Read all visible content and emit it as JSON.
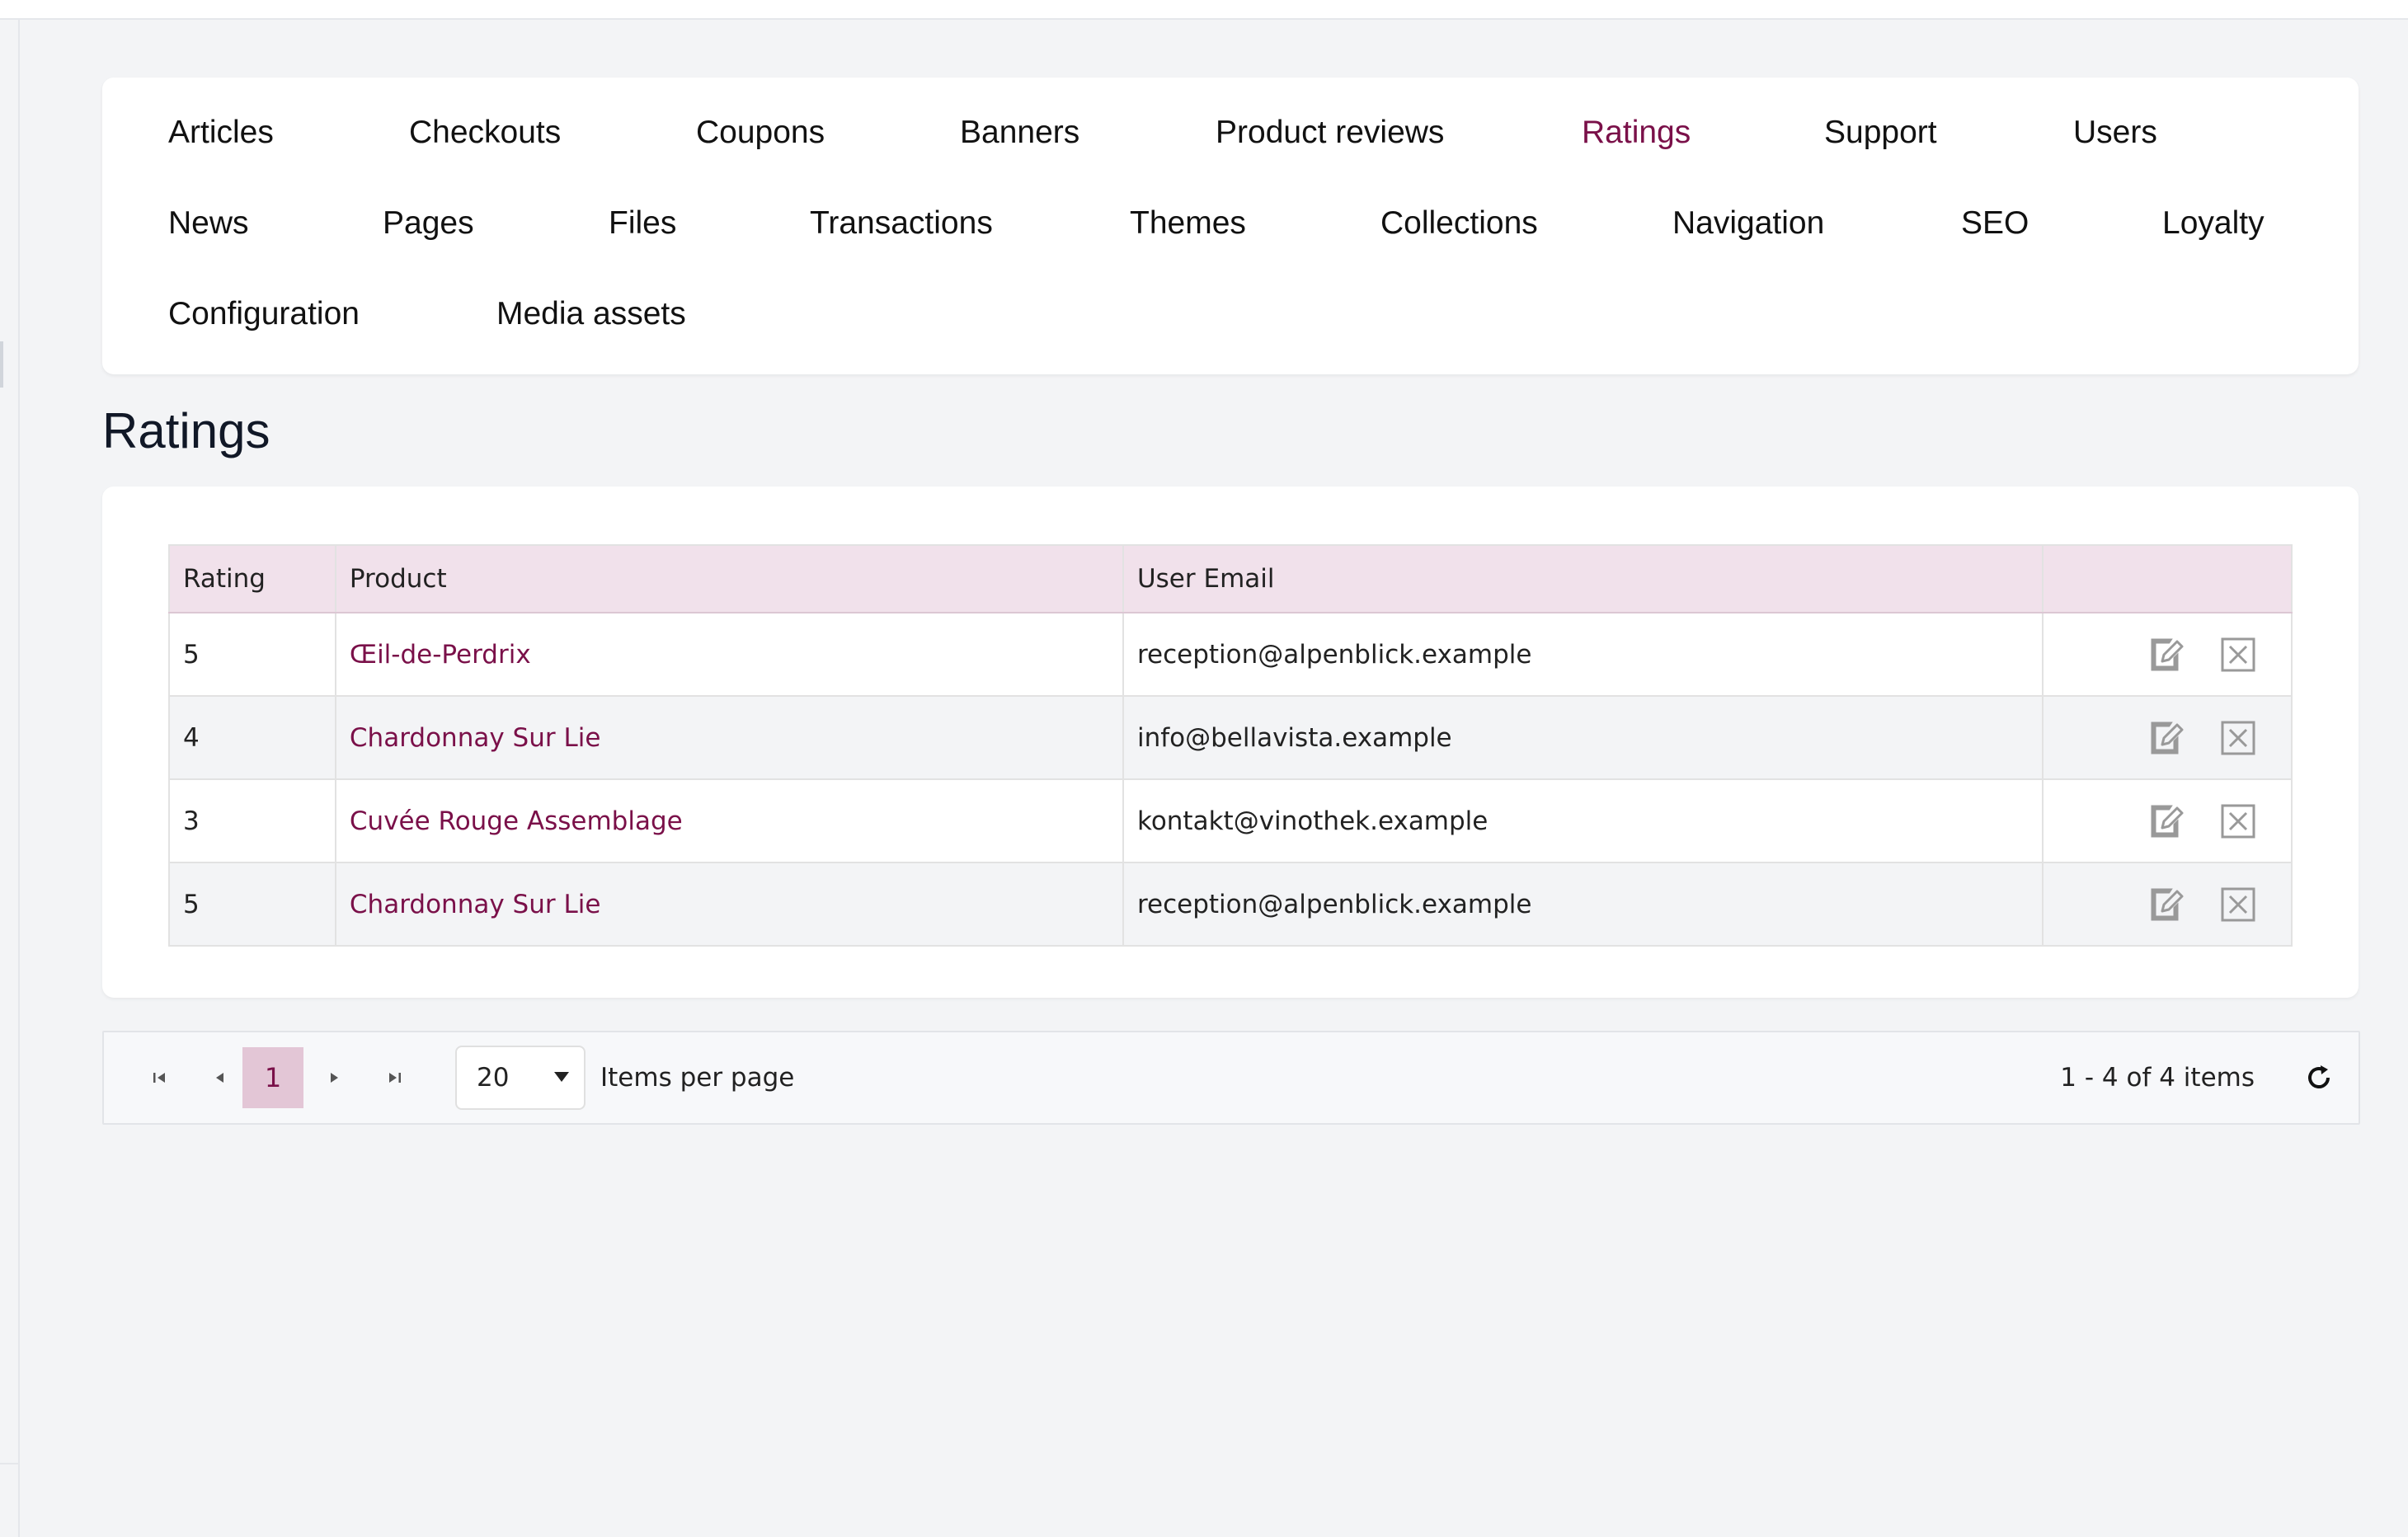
{
  "nav": {
    "items": [
      {
        "label": "Articles"
      },
      {
        "label": "Checkouts"
      },
      {
        "label": "Coupons"
      },
      {
        "label": "Banners"
      },
      {
        "label": "Product reviews"
      },
      {
        "label": "Ratings",
        "active": true
      },
      {
        "label": "Support"
      },
      {
        "label": "Users"
      },
      {
        "label": "News"
      },
      {
        "label": "Pages"
      },
      {
        "label": "Files"
      },
      {
        "label": "Transactions"
      },
      {
        "label": "Themes"
      },
      {
        "label": "Collections"
      },
      {
        "label": "Navigation"
      },
      {
        "label": "SEO"
      },
      {
        "label": "Loyalty"
      },
      {
        "label": "Configuration"
      },
      {
        "label": "Media assets"
      }
    ]
  },
  "page": {
    "title": "Ratings"
  },
  "table": {
    "headers": {
      "rating": "Rating",
      "product": "Product",
      "email": "User Email",
      "actions": ""
    },
    "rows": [
      {
        "rating": "5",
        "product": "Œil-de-Perdrix",
        "email": "reception@alpenblick.example"
      },
      {
        "rating": "4",
        "product": "Chardonnay Sur Lie",
        "email": "info@bellavista.example"
      },
      {
        "rating": "3",
        "product": "Cuvée Rouge Assemblage",
        "email": "kontakt@vinothek.example"
      },
      {
        "rating": "5",
        "product": "Chardonnay Sur Lie",
        "email": "reception@alpenblick.example"
      }
    ],
    "row_actions": [
      "edit-icon",
      "delete-icon"
    ]
  },
  "pager": {
    "current_page": "1",
    "page_size": "20",
    "items_per_page_label": "Items per page",
    "info": "1 - 4 of 4 items"
  },
  "colors": {
    "accent": "#7a1049",
    "header_bg": "#f1e1eb",
    "page_bg": "#f3f4f6"
  }
}
